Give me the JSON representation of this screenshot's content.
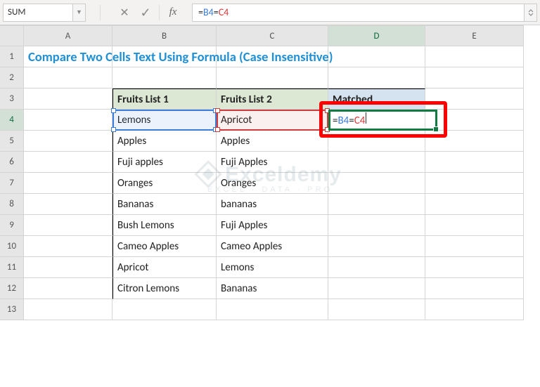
{
  "name_box": "SUM",
  "formula": {
    "prefix": "=",
    "ref1": "B4",
    "eq": "=",
    "ref2": "C4"
  },
  "columns": [
    "A",
    "B",
    "C",
    "D",
    "E"
  ],
  "rows": [
    "1",
    "2",
    "3",
    "4",
    "5",
    "6",
    "7",
    "8",
    "9",
    "10",
    "11",
    "12",
    "13"
  ],
  "title": "Compare Two Cells Text Using Formula (Case Insensitive)",
  "headers": {
    "col1": "Fruits List 1",
    "col2": "Fruits List 2",
    "col3": "Matched"
  },
  "table": [
    {
      "c1": "Lemons",
      "c2": "Apricot"
    },
    {
      "c1": "Apples",
      "c2": "Apples"
    },
    {
      "c1": "Fuji apples",
      "c2": "Fuji Apples"
    },
    {
      "c1": "Oranges",
      "c2": "Oranges"
    },
    {
      "c1": "Bananas",
      "c2": "bananas"
    },
    {
      "c1": "Bush Lemons",
      "c2": "Fuji Apples"
    },
    {
      "c1": "Cameo Apples",
      "c2": "Cameo Apples"
    },
    {
      "c1": "Apricot",
      "c2": "Lemons"
    },
    {
      "c1": "Citron Lemons",
      "c2": "Bananas"
    }
  ],
  "watermark": {
    "line1": "Exceldemy",
    "line2": "EXCEL · DATA · PRO"
  }
}
